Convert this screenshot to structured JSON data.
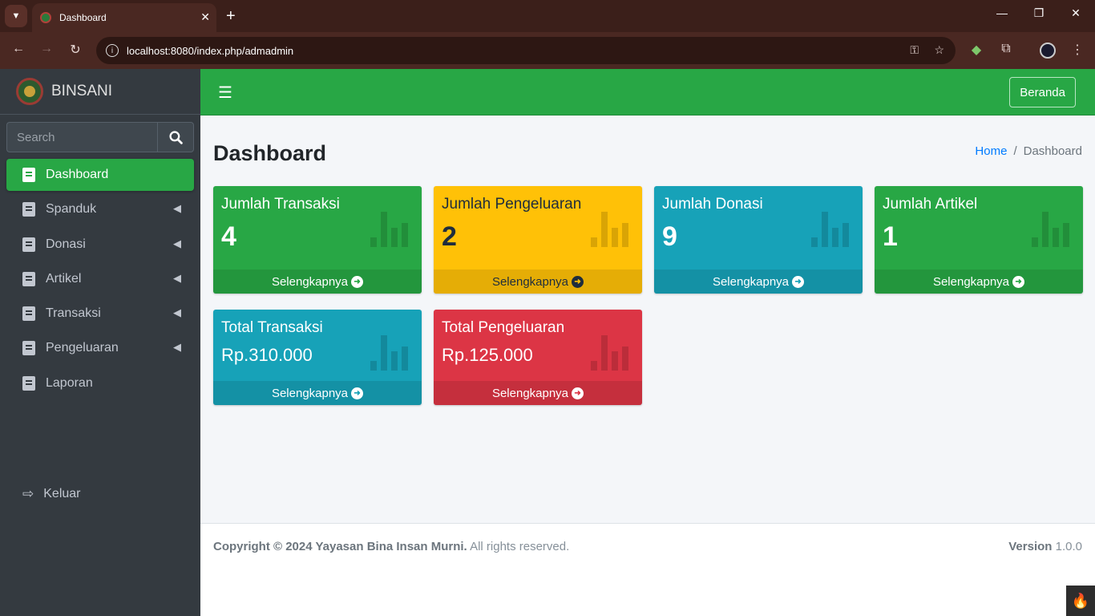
{
  "browser": {
    "tab_title": "Dashboard",
    "url": "localhost:8080/index.php/admadmin"
  },
  "sidebar": {
    "brand": "BINSANI",
    "search_placeholder": "Search",
    "items": [
      {
        "label": "Dashboard",
        "active": true,
        "has_submenu": false
      },
      {
        "label": "Spanduk",
        "active": false,
        "has_submenu": true
      },
      {
        "label": "Donasi",
        "active": false,
        "has_submenu": true
      },
      {
        "label": "Artikel",
        "active": false,
        "has_submenu": true
      },
      {
        "label": "Transaksi",
        "active": false,
        "has_submenu": true
      },
      {
        "label": "Pengeluaran",
        "active": false,
        "has_submenu": true
      },
      {
        "label": "Laporan",
        "active": false,
        "has_submenu": false
      }
    ],
    "logout": "Keluar"
  },
  "navbar": {
    "beranda": "Beranda"
  },
  "content": {
    "title": "Dashboard",
    "breadcrumb": {
      "home": "Home",
      "sep": "/",
      "current": "Dashboard"
    },
    "boxes": [
      {
        "title": "Jumlah Transaksi",
        "value": "4",
        "footer": "Selengkapnya",
        "color": "#28a745"
      },
      {
        "title": "Jumlah Pengeluaran",
        "value": "2",
        "footer": "Selengkapnya",
        "color": "#ffc107"
      },
      {
        "title": "Jumlah Donasi",
        "value": "9",
        "footer": "Selengkapnya",
        "color": "#17a2b8"
      },
      {
        "title": "Jumlah Artikel",
        "value": "1",
        "footer": "Selengkapnya",
        "color": "#28a745"
      },
      {
        "title": "Total Transaksi",
        "value": "Rp.310.000",
        "footer": "Selengkapnya",
        "color": "#17a2b8"
      },
      {
        "title": "Total Pengeluaran",
        "value": "Rp.125.000",
        "footer": "Selengkapnya",
        "color": "#dc3545"
      }
    ]
  },
  "footer": {
    "copyright_bold": "Copyright © 2024 Yayasan Bina Insan Murni.",
    "copyright_rest": "All rights reserved.",
    "version_label": "Version",
    "version_value": "1.0.0"
  }
}
